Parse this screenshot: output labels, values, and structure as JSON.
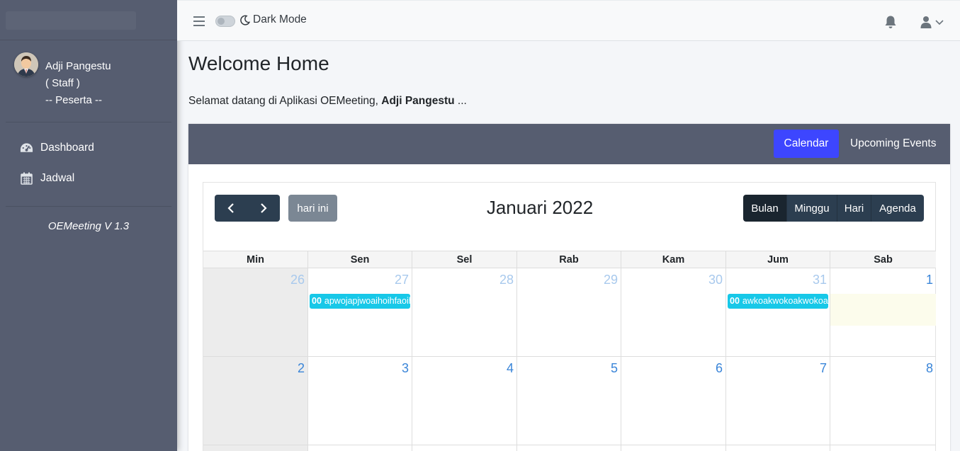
{
  "topnav": {
    "dark_mode_label": "Dark Mode"
  },
  "sidebar": {
    "user": {
      "name": "Adji Pangestu",
      "role": "( Staff )",
      "group": "-- Peserta --"
    },
    "items": [
      {
        "label": "Dashboard",
        "icon": "dashboard-icon"
      },
      {
        "label": "Jadwal",
        "icon": "calendar-icon"
      }
    ],
    "version": "OEMeeting V 1.3"
  },
  "page": {
    "title": "Welcome Home",
    "welcome_prefix": "Selamat datang di Aplikasi OEMeeting, ",
    "welcome_name": "Adji Pangestu",
    "welcome_suffix": " ..."
  },
  "card": {
    "tabs": [
      {
        "label": "Calendar",
        "active": true
      },
      {
        "label": "Upcoming Events",
        "active": false
      }
    ]
  },
  "calendar": {
    "today_button": "hari ini",
    "title": "Januari 2022",
    "views": [
      {
        "label": "Bulan",
        "active": true
      },
      {
        "label": "Minggu",
        "active": false
      },
      {
        "label": "Hari",
        "active": false
      },
      {
        "label": "Agenda",
        "active": false
      }
    ],
    "weekdays": [
      "Min",
      "Sen",
      "Sel",
      "Rab",
      "Kam",
      "Jum",
      "Sab"
    ],
    "weeks": [
      [
        "26",
        "27",
        "28",
        "29",
        "30",
        "31",
        "1"
      ],
      [
        "2",
        "3",
        "4",
        "5",
        "6",
        "7",
        "8"
      ]
    ],
    "events": [
      {
        "time": "00",
        "title": "apwojapjwoaihoihfaoih"
      },
      {
        "time": "00",
        "title": "awkoakwokoakwokoakwo"
      }
    ],
    "colors": {
      "event": "#17c8e8",
      "primary": "#2c3e50",
      "accent": "#3d46ff"
    }
  }
}
